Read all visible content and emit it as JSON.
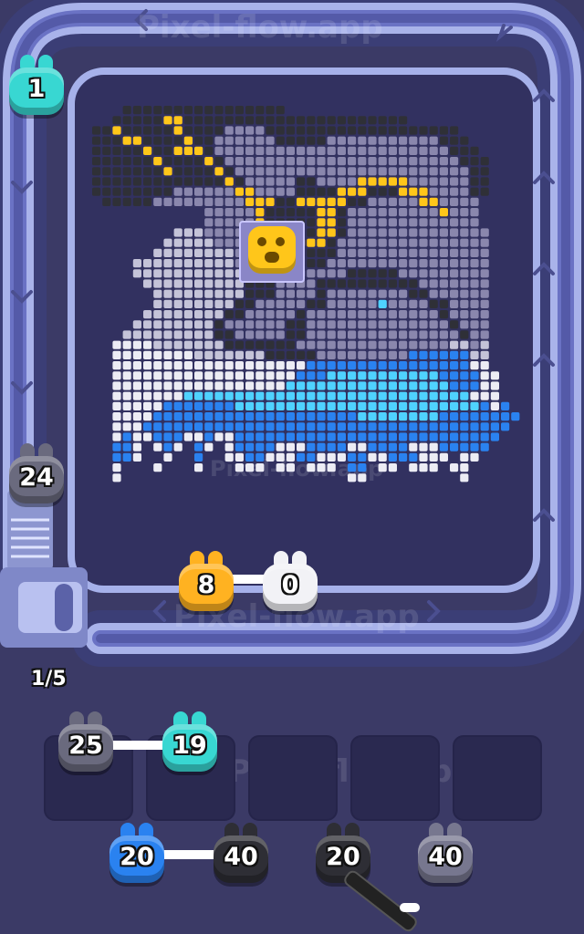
{
  "watermark": "Pixel-flow.app",
  "progress": "1/5",
  "pixel_art_rows": [
    "...KKKKKKKKKKKKKKKK....................",
    "..KKKKKYYKKKKKKKKKKKKKKKKKKKKKK........",
    "KKYKKKKKYKKKKDDDDKKKKKKKKKKKKKKKKKKK...",
    "KKKYYKKKKYKKDDDDDDKKKKKDDDDDDDDDDDKKK..",
    "KKKKKYKKYYYKDDDDDDDDDDDDDDDDDDDDDDDKKK.",
    "KKKKKKYKKKKYKDDDDDDDDDDDDDDDDDDDDDDDKKK",
    "KKKKKKKYKKKKYKDDDDDDDDDDDDDDDDDDDDDDDKK",
    "KKKKKKKKKKKKKYKDDDDDKKDDDDYYYYYDDDDDDKK",
    "KKKKKKKKDDDDDDYYDDDDKKKKYYYKKKYYYDDDDKK",
    ".KKKKKDDDDDDDDDYYYKKYYYYYKKDDDDDYYDDDD.",
    "...........DDDDDYKKKKKYYKDDDDDDDDDYDDD.",
    "...........DDDDDYKKKKKYYKDDDDDDDDDDDDD.",
    "........LLLDDDDDDYKKKKYYKDDDDDDDDDDDDDD",
    ".......LLLLLDDDDDDYYYYYKDDDDDDDDDDDDDDD",
    "......LLLLLLLLDDDDDKKKKKDDDDDDDDDDDDDDD",
    "....LLLLLLLLLLDDDDKKKKKDDDDDDDDDDDDDDDD",
    "....LLLLLLLLLLLDDDKKDDDDDKKKKKDDDDDDDDD",
    ".....LLLLLLLLLLKKKDDDDKKKKKKKKKKDDDDDDD",
    "......LLLLLLLLLKKKDDDDKDDDDDDDDKKDDDDDD",
    "......LLLLLLLLKKDDDDDKKDDDDDCDDDDKKDDDD",
    ".....LLLLLLLLKKDDDDDKDDDDDDDDDDDDDKDDDD",
    "....LLLLLLLLKDDDDDDKKDDDDDDDDDDDDDDKDDD",
    "...LLLLLLLLLKKDDDDDKKDDDDDDDDDDDDDDDKDD",
    "..WWWWLLLLLLLKKKKKKKDDDDDDDDDDDDDDDLLDL",
    "..WWWWWWWWLLLLLLLKKKKKDDDDDDDDDBBBBBBLL",
    "..WWWWWWWWWWWWWWWWWWWBBBBBBBBBBBBBBBBWW",
    "..WWWWWWWWWWWWWWWWWWBBBCCCCCCCCCCCBBBBWW",
    "..WWWWWWWWWWWWWWWWWCCCCCCCCCCCCCCCCBBBWW",
    "..WWWWWWWCCCCCCCCCCCCCCCCCCCCCCCCCCCCWWW",
    "..WWWWWBBBBBBBCCCCCCCCCCCCCCCCCCCCCCCCBWB",
    "..WWWWBBBBBBBBBBBBBBBBBBBBCCCCCCCCBBBBBBBB",
    "..WWWBBBBBBBBBBBBBBBBBBBBBBBBBBBBBBBBBBBB",
    "..WBWWBBBWWBWWBBBBBBBBBBBBBBBBBBBBBBBBBB.",
    "..BBW.WBW.BW.WBBBBWWWBBBBWWBBBBWWWBBBBB.",
    "..BBW..W..B..WWBBWWWBBWWWBBWWBBBWWW.WW..",
    "..W...W...W...WWW.WW.WWW.BB.WW.WWW.WW.",
    "..W......................WW.........W."
  ],
  "pixel_palette": {
    "K": "#2f3037",
    "D": "#8a87ad",
    "L": "#c4c3d8",
    "W": "#ececf4",
    "B": "#2a82f0",
    "C": "#4fd2ff",
    "Y": "#ffc61a"
  },
  "units": {
    "track_top_left": {
      "value": "1",
      "color": "#38d7d2"
    },
    "track_left": {
      "value": "24",
      "color": "#6a6a7e"
    },
    "conveyor_orange": {
      "value": "8",
      "color": "#ffb221"
    },
    "conveyor_white": {
      "value": "0",
      "color": "#f2f2f6"
    },
    "queue": [
      {
        "value": "25",
        "color": "#6a6a7e"
      },
      {
        "value": "19",
        "color": "#38d7d2"
      }
    ],
    "bottom": [
      {
        "value": "20",
        "color": "#2a82f0"
      },
      {
        "value": "40",
        "color": "#2e2e35"
      },
      {
        "value": "20",
        "color": "#2e2e35"
      },
      {
        "value": "40",
        "color": "#77778f"
      }
    ]
  }
}
